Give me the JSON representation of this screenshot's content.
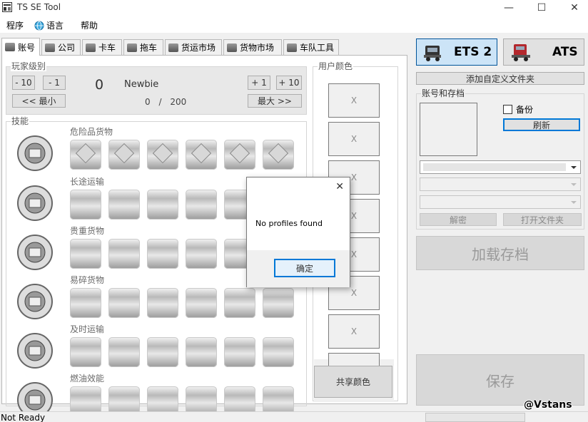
{
  "window": {
    "title": "TS SE Tool",
    "minimize": "—",
    "maximize": "☐",
    "close": "✕"
  },
  "menu": [
    {
      "label": "程序"
    },
    {
      "label": "语言"
    },
    {
      "label": "帮助"
    }
  ],
  "tabs": [
    {
      "label": "账号",
      "active": true
    },
    {
      "label": "公司"
    },
    {
      "label": "卡车"
    },
    {
      "label": "拖车"
    },
    {
      "label": "货运市场"
    },
    {
      "label": "货物市场"
    },
    {
      "label": "车队工具"
    }
  ],
  "player_level": {
    "group_label": "玩家级别",
    "minus10": "- 10",
    "minus1": "- 1",
    "level": "0",
    "rank": "Newbie",
    "plus1": "+ 1",
    "plus10": "+ 10",
    "min_button": "<< 最小",
    "max_button": "最大 >>",
    "xp_current": "0",
    "xp_sep": "/",
    "xp_max": "200"
  },
  "skills": {
    "group_label": "技能",
    "rows": [
      {
        "label": "危险品货物",
        "icon": "hazardous-cargo-icon"
      },
      {
        "label": "长途运输",
        "icon": "long-distance-icon"
      },
      {
        "label": "贵重货物",
        "icon": "valuable-cargo-icon"
      },
      {
        "label": "易碎货物",
        "icon": "fragile-cargo-icon"
      },
      {
        "label": "及时运输",
        "icon": "just-in-time-icon"
      },
      {
        "label": "燃油效能",
        "icon": "fuel-economy-icon"
      }
    ]
  },
  "user_colors": {
    "group_label": "用户颜色",
    "cells": [
      "X",
      "X",
      "X",
      "X",
      "X",
      "X",
      "X"
    ],
    "share_button": "共享颜色"
  },
  "games": {
    "ets2": "ETS 2",
    "ats": "ATS"
  },
  "add_folder_button": "添加自定义文件夹",
  "profiles": {
    "group_label": "账号和存档",
    "backup_label": "备份",
    "refresh_button": "刷新",
    "decrypt_button": "解密",
    "open_folder_button": "打开文件夹"
  },
  "load_button": "加载存档",
  "save_button": "保存",
  "dialog": {
    "message": "No profiles found",
    "ok_button": "确定",
    "close": "✕"
  },
  "status": {
    "text": "Not Ready"
  },
  "watermark": "@Vstans",
  "colors": {
    "accent": "#005499",
    "active_game_bg": "#cce4f7"
  }
}
